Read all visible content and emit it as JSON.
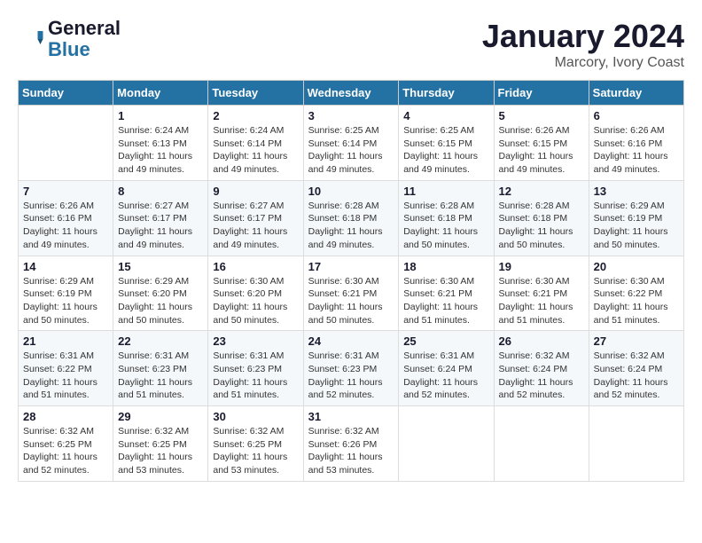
{
  "logo": {
    "text_general": "General",
    "text_blue": "Blue"
  },
  "title": "January 2024",
  "subtitle": "Marcory, Ivory Coast",
  "days_of_week": [
    "Sunday",
    "Monday",
    "Tuesday",
    "Wednesday",
    "Thursday",
    "Friday",
    "Saturday"
  ],
  "weeks": [
    [
      {
        "day": "",
        "info": ""
      },
      {
        "day": "1",
        "info": "Sunrise: 6:24 AM\nSunset: 6:13 PM\nDaylight: 11 hours\nand 49 minutes."
      },
      {
        "day": "2",
        "info": "Sunrise: 6:24 AM\nSunset: 6:14 PM\nDaylight: 11 hours\nand 49 minutes."
      },
      {
        "day": "3",
        "info": "Sunrise: 6:25 AM\nSunset: 6:14 PM\nDaylight: 11 hours\nand 49 minutes."
      },
      {
        "day": "4",
        "info": "Sunrise: 6:25 AM\nSunset: 6:15 PM\nDaylight: 11 hours\nand 49 minutes."
      },
      {
        "day": "5",
        "info": "Sunrise: 6:26 AM\nSunset: 6:15 PM\nDaylight: 11 hours\nand 49 minutes."
      },
      {
        "day": "6",
        "info": "Sunrise: 6:26 AM\nSunset: 6:16 PM\nDaylight: 11 hours\nand 49 minutes."
      }
    ],
    [
      {
        "day": "7",
        "info": "Sunrise: 6:26 AM\nSunset: 6:16 PM\nDaylight: 11 hours\nand 49 minutes."
      },
      {
        "day": "8",
        "info": "Sunrise: 6:27 AM\nSunset: 6:17 PM\nDaylight: 11 hours\nand 49 minutes."
      },
      {
        "day": "9",
        "info": "Sunrise: 6:27 AM\nSunset: 6:17 PM\nDaylight: 11 hours\nand 49 minutes."
      },
      {
        "day": "10",
        "info": "Sunrise: 6:28 AM\nSunset: 6:18 PM\nDaylight: 11 hours\nand 49 minutes."
      },
      {
        "day": "11",
        "info": "Sunrise: 6:28 AM\nSunset: 6:18 PM\nDaylight: 11 hours\nand 50 minutes."
      },
      {
        "day": "12",
        "info": "Sunrise: 6:28 AM\nSunset: 6:18 PM\nDaylight: 11 hours\nand 50 minutes."
      },
      {
        "day": "13",
        "info": "Sunrise: 6:29 AM\nSunset: 6:19 PM\nDaylight: 11 hours\nand 50 minutes."
      }
    ],
    [
      {
        "day": "14",
        "info": "Sunrise: 6:29 AM\nSunset: 6:19 PM\nDaylight: 11 hours\nand 50 minutes."
      },
      {
        "day": "15",
        "info": "Sunrise: 6:29 AM\nSunset: 6:20 PM\nDaylight: 11 hours\nand 50 minutes."
      },
      {
        "day": "16",
        "info": "Sunrise: 6:30 AM\nSunset: 6:20 PM\nDaylight: 11 hours\nand 50 minutes."
      },
      {
        "day": "17",
        "info": "Sunrise: 6:30 AM\nSunset: 6:21 PM\nDaylight: 11 hours\nand 50 minutes."
      },
      {
        "day": "18",
        "info": "Sunrise: 6:30 AM\nSunset: 6:21 PM\nDaylight: 11 hours\nand 51 minutes."
      },
      {
        "day": "19",
        "info": "Sunrise: 6:30 AM\nSunset: 6:21 PM\nDaylight: 11 hours\nand 51 minutes."
      },
      {
        "day": "20",
        "info": "Sunrise: 6:30 AM\nSunset: 6:22 PM\nDaylight: 11 hours\nand 51 minutes."
      }
    ],
    [
      {
        "day": "21",
        "info": "Sunrise: 6:31 AM\nSunset: 6:22 PM\nDaylight: 11 hours\nand 51 minutes."
      },
      {
        "day": "22",
        "info": "Sunrise: 6:31 AM\nSunset: 6:23 PM\nDaylight: 11 hours\nand 51 minutes."
      },
      {
        "day": "23",
        "info": "Sunrise: 6:31 AM\nSunset: 6:23 PM\nDaylight: 11 hours\nand 51 minutes."
      },
      {
        "day": "24",
        "info": "Sunrise: 6:31 AM\nSunset: 6:23 PM\nDaylight: 11 hours\nand 52 minutes."
      },
      {
        "day": "25",
        "info": "Sunrise: 6:31 AM\nSunset: 6:24 PM\nDaylight: 11 hours\nand 52 minutes."
      },
      {
        "day": "26",
        "info": "Sunrise: 6:32 AM\nSunset: 6:24 PM\nDaylight: 11 hours\nand 52 minutes."
      },
      {
        "day": "27",
        "info": "Sunrise: 6:32 AM\nSunset: 6:24 PM\nDaylight: 11 hours\nand 52 minutes."
      }
    ],
    [
      {
        "day": "28",
        "info": "Sunrise: 6:32 AM\nSunset: 6:25 PM\nDaylight: 11 hours\nand 52 minutes."
      },
      {
        "day": "29",
        "info": "Sunrise: 6:32 AM\nSunset: 6:25 PM\nDaylight: 11 hours\nand 53 minutes."
      },
      {
        "day": "30",
        "info": "Sunrise: 6:32 AM\nSunset: 6:25 PM\nDaylight: 11 hours\nand 53 minutes."
      },
      {
        "day": "31",
        "info": "Sunrise: 6:32 AM\nSunset: 6:26 PM\nDaylight: 11 hours\nand 53 minutes."
      },
      {
        "day": "",
        "info": ""
      },
      {
        "day": "",
        "info": ""
      },
      {
        "day": "",
        "info": ""
      }
    ]
  ]
}
